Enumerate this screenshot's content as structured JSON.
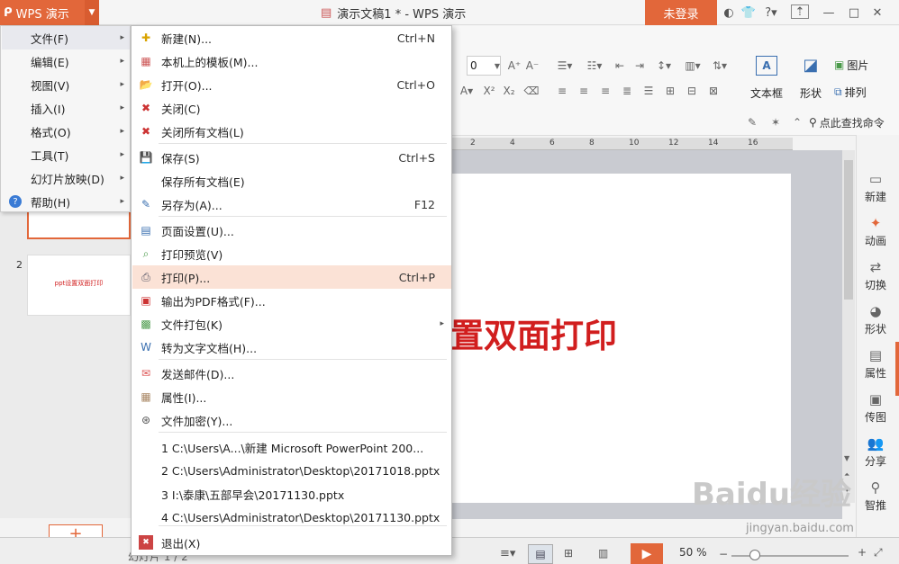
{
  "app": {
    "logo_label": "WPS 演示",
    "window_title": "演示文稿1 * - WPS 演示",
    "login_label": "未登录",
    "accent_color": "#e2673a"
  },
  "main_menu": {
    "items": [
      {
        "label": "文件(F)",
        "selected": true
      },
      {
        "label": "编辑(E)"
      },
      {
        "label": "视图(V)"
      },
      {
        "label": "插入(I)"
      },
      {
        "label": "格式(O)"
      },
      {
        "label": "工具(T)"
      },
      {
        "label": "幻灯片放映(D)"
      },
      {
        "label": "帮助(H)"
      }
    ]
  },
  "file_menu": {
    "items": [
      {
        "label": "新建(N)...",
        "shortcut": "Ctrl+N",
        "icon": "new-doc-icon"
      },
      {
        "label": "本机上的模板(M)...",
        "shortcut": "",
        "icon": "template-icon"
      },
      {
        "label": "打开(O)...",
        "shortcut": "Ctrl+O",
        "icon": "folder-open-icon"
      },
      {
        "label": "关闭(C)",
        "shortcut": "",
        "icon": "close-doc-icon"
      },
      {
        "label": "关闭所有文档(L)",
        "shortcut": "",
        "icon": "close-all-icon"
      },
      {
        "label": "保存(S)",
        "shortcut": "Ctrl+S",
        "icon": "save-icon"
      },
      {
        "label": "保存所有文档(E)",
        "shortcut": "",
        "icon": ""
      },
      {
        "label": "另存为(A)...",
        "shortcut": "F12",
        "icon": "save-as-icon"
      },
      {
        "label": "页面设置(U)...",
        "shortcut": "",
        "icon": "page-setup-icon"
      },
      {
        "label": "打印预览(V)",
        "shortcut": "",
        "icon": "print-preview-icon"
      },
      {
        "label": "打印(P)...",
        "shortcut": "Ctrl+P",
        "icon": "printer-icon",
        "highlighted": true
      },
      {
        "label": "输出为PDF格式(F)...",
        "shortcut": "",
        "icon": "pdf-icon"
      },
      {
        "label": "文件打包(K)",
        "shortcut": "",
        "icon": "package-icon",
        "submenu": true
      },
      {
        "label": "转为文字文档(H)...",
        "shortcut": "",
        "icon": "convert-icon"
      },
      {
        "label": "发送邮件(D)...",
        "shortcut": "",
        "icon": "mail-icon"
      },
      {
        "label": "属性(I)...",
        "shortcut": "",
        "icon": "properties-icon"
      },
      {
        "label": "文件加密(Y)...",
        "shortcut": "",
        "icon": "encrypt-icon"
      }
    ],
    "recent_files": [
      "1 C:\\Users\\A...\\新建 Microsoft PowerPoint 200...",
      "2 C:\\Users\\Administrator\\Desktop\\20171018.pptx",
      "3 I:\\泰康\\五部早会\\20171130.pptx",
      "4 C:\\Users\\Administrator\\Desktop\\20171130.pptx"
    ],
    "exit_label": "退出(X)"
  },
  "ribbon": {
    "font_size_value": "0",
    "textbox_label": "文本框",
    "shape_label": "形状",
    "picture_label": "图片",
    "arrange_label": "排列",
    "search_label": "点此查找命令",
    "ruler_ticks": [
      "2",
      "4",
      "6",
      "8",
      "10",
      "12",
      "14",
      "16"
    ]
  },
  "slides": {
    "thumb2_number": "2",
    "thumb2_text": "ppt设置双面打印",
    "add_slide_label": "+",
    "slide_title_fragment": "置双面打印"
  },
  "right_panel": {
    "items": [
      {
        "label": "新建",
        "icon": "new-icon"
      },
      {
        "label": "动画",
        "icon": "animation-icon"
      },
      {
        "label": "切换",
        "icon": "switch-icon"
      },
      {
        "label": "形状",
        "icon": "shape-icon"
      },
      {
        "label": "属性",
        "icon": "property-icon"
      },
      {
        "label": "传图",
        "icon": "upload-image-icon"
      },
      {
        "label": "分享",
        "icon": "share-icon"
      },
      {
        "label": "智推",
        "icon": "smart-push-icon"
      }
    ]
  },
  "status": {
    "slide_count": "幻灯片 1 / 2",
    "zoom": "50 %",
    "zoom_fraction": 0.2
  },
  "watermark": {
    "brand": "Baidu经验",
    "url": "jingyan.baidu.com"
  }
}
